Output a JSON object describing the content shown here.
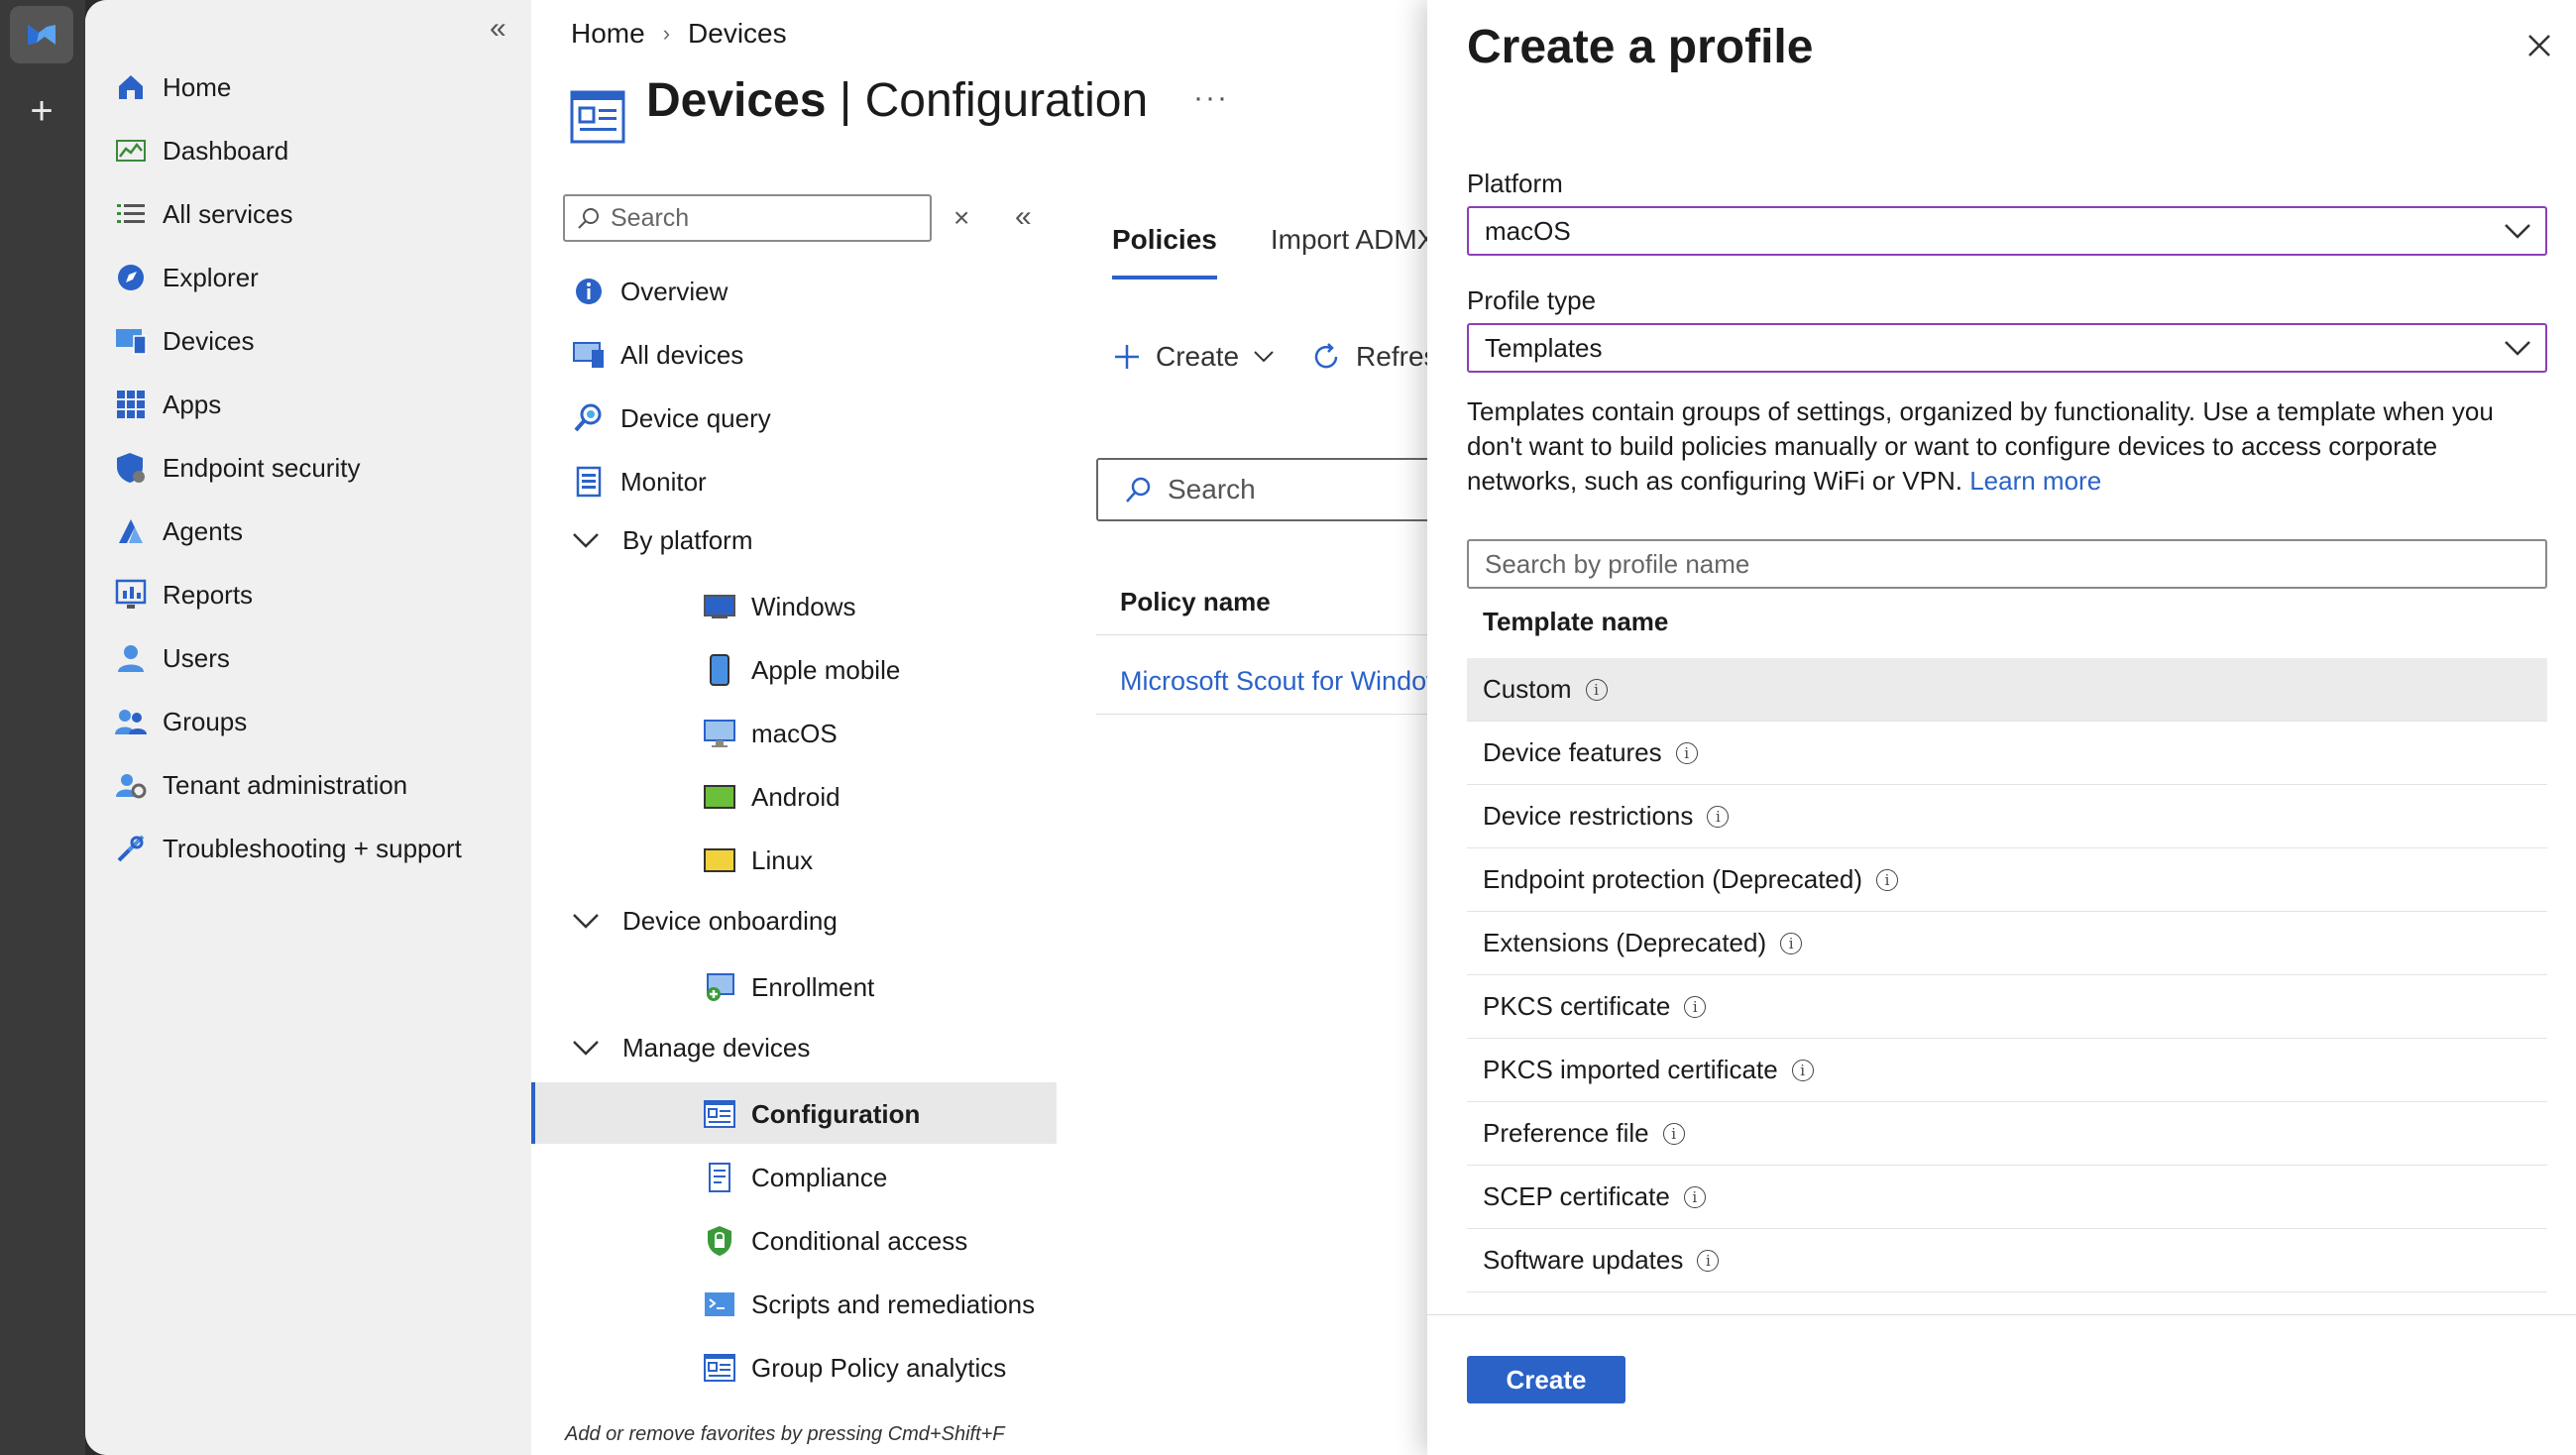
{
  "rail": {
    "plus_label": "+"
  },
  "leftnav": {
    "collapse_glyph": "«",
    "items": [
      {
        "label": "Home",
        "icon": "home-icon"
      },
      {
        "label": "Dashboard",
        "icon": "dashboard-icon"
      },
      {
        "label": "All services",
        "icon": "list-icon"
      },
      {
        "label": "Explorer",
        "icon": "explorer-icon"
      },
      {
        "label": "Devices",
        "icon": "devices-icon"
      },
      {
        "label": "Apps",
        "icon": "apps-icon"
      },
      {
        "label": "Endpoint security",
        "icon": "shield-icon"
      },
      {
        "label": "Agents",
        "icon": "agents-icon"
      },
      {
        "label": "Reports",
        "icon": "reports-icon"
      },
      {
        "label": "Users",
        "icon": "user-icon"
      },
      {
        "label": "Groups",
        "icon": "groups-icon"
      },
      {
        "label": "Tenant administration",
        "icon": "tenant-admin-icon"
      },
      {
        "label": "Troubleshooting + support",
        "icon": "wrench-icon"
      }
    ]
  },
  "breadcrumb": {
    "home": "Home",
    "sep": "›",
    "current": "Devices"
  },
  "page": {
    "title_bold": "Devices",
    "title_rest": " | Configuration",
    "more": "···"
  },
  "menu": {
    "search_placeholder": "Search",
    "clear_glyph": "×",
    "collapse_glyph": "«",
    "overview": "Overview",
    "all_devices": "All devices",
    "device_query": "Device query",
    "monitor": "Monitor",
    "by_platform": "By platform",
    "windows": "Windows",
    "apple_mobile": "Apple mobile",
    "macos": "macOS",
    "android": "Android",
    "linux": "Linux",
    "device_onboarding": "Device onboarding",
    "enrollment": "Enrollment",
    "manage_devices": "Manage devices",
    "configuration": "Configuration",
    "compliance": "Compliance",
    "conditional_access": "Conditional access",
    "scripts": "Scripts and remediations",
    "gp_analytics": "Group Policy analytics",
    "footer_note": "Add or remove favorites by pressing Cmd+Shift+F"
  },
  "content": {
    "tabs": [
      "Policies",
      "Import ADMX"
    ],
    "create": "Create",
    "refresh": "Refresh",
    "search_placeholder": "Search",
    "column_policy_name": "Policy name",
    "policy_row": "Microsoft Scout for Windows"
  },
  "panel": {
    "title": "Create a profile",
    "platform_label": "Platform",
    "platform_value": "macOS",
    "profile_type_label": "Profile type",
    "profile_type_value": "Templates",
    "description": "Templates contain groups of settings, organized by functionality. Use a template when you don't want to build policies manually or want to configure devices to access corporate networks, such as configuring WiFi or VPN.",
    "learn_more": "Learn more",
    "search_placeholder": "Search by profile name",
    "template_header": "Template name",
    "info_glyph": "i",
    "templates": [
      "Custom",
      "Device features",
      "Device restrictions",
      "Endpoint protection (Deprecated)",
      "Extensions (Deprecated)",
      "PKCS certificate",
      "PKCS imported certificate",
      "Preference file",
      "SCEP certificate",
      "Software updates"
    ],
    "create_button": "Create"
  },
  "colors": {
    "accent": "#2b62c8",
    "focus_border": "#8b3fb5",
    "nav_bg": "#f0f0f0"
  }
}
